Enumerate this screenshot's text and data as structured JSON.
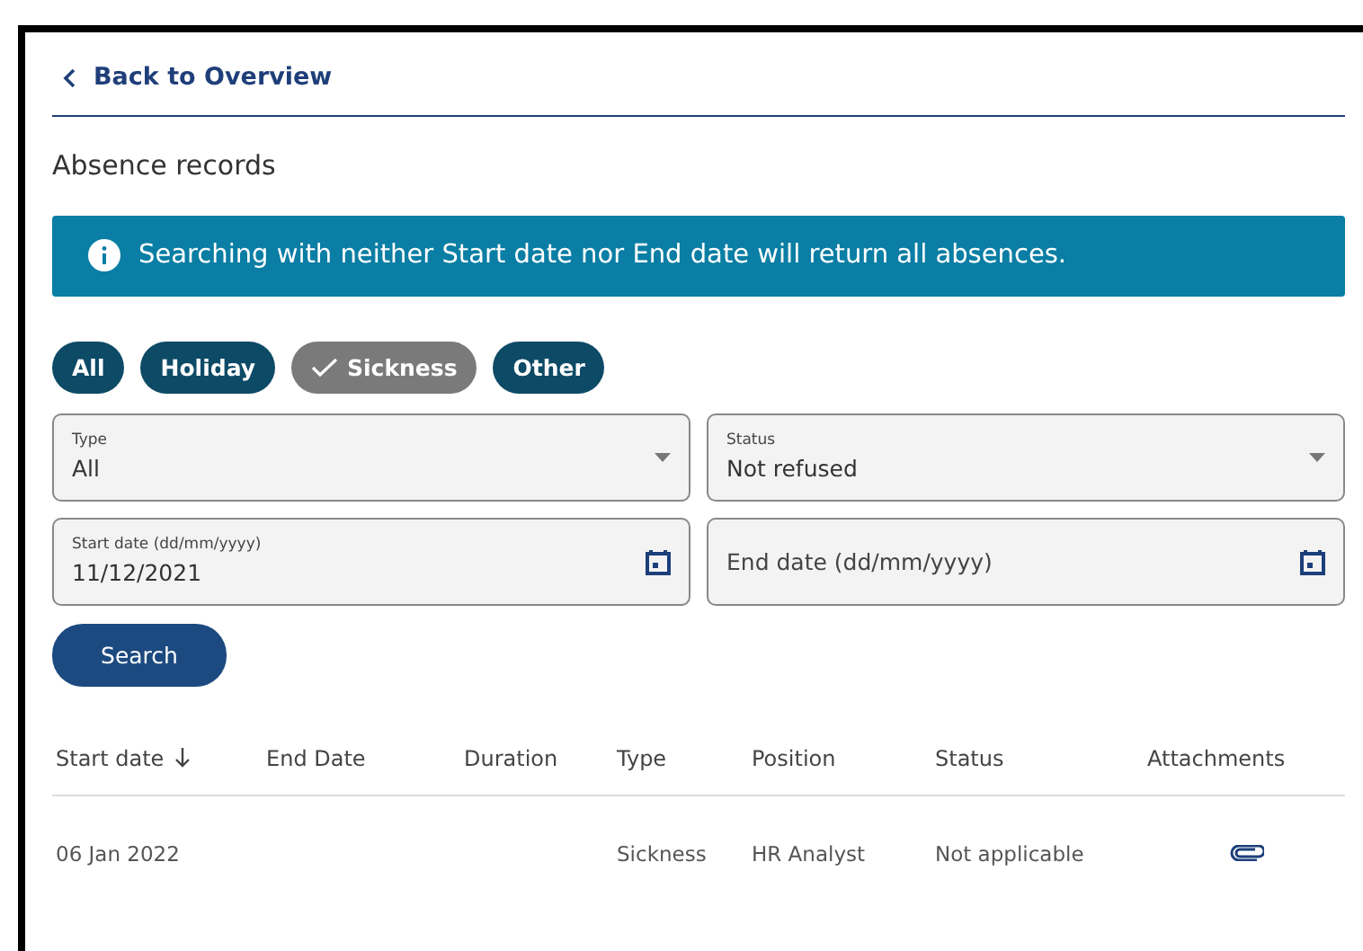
{
  "back_link": {
    "label": "Back to Overview"
  },
  "heading": "Absence records",
  "info_banner": {
    "text": "Searching with neither Start date nor End date will return all absences."
  },
  "filter_chips": [
    {
      "label": "All",
      "selected": false
    },
    {
      "label": "Holiday",
      "selected": false
    },
    {
      "label": "Sickness",
      "selected": true
    },
    {
      "label": "Other",
      "selected": false
    }
  ],
  "fields": [
    {
      "kind": "select",
      "label": "Type",
      "value": "All"
    },
    {
      "kind": "select",
      "label": "Status",
      "value": "Not refused"
    },
    {
      "kind": "date",
      "label": "Start date (dd/mm/yyyy)",
      "value": "11/12/2021"
    },
    {
      "kind": "date",
      "placeholder": "End date (dd/mm/yyyy)"
    }
  ],
  "search_button": "Search",
  "table": {
    "columns": [
      {
        "label": "Start date",
        "sorted": true
      },
      {
        "label": "End Date",
        "sorted": false
      },
      {
        "label": "Duration",
        "sorted": false
      },
      {
        "label": "Type",
        "sorted": false
      },
      {
        "label": "Position",
        "sorted": false
      },
      {
        "label": "Status",
        "sorted": false
      },
      {
        "label": "Attachments",
        "sorted": false
      }
    ],
    "rows": [
      {
        "start_date": "06 Jan 2022",
        "type": "Sickness",
        "position": "HR Analyst",
        "status": "Not applicable",
        "attachment": true
      }
    ]
  }
}
